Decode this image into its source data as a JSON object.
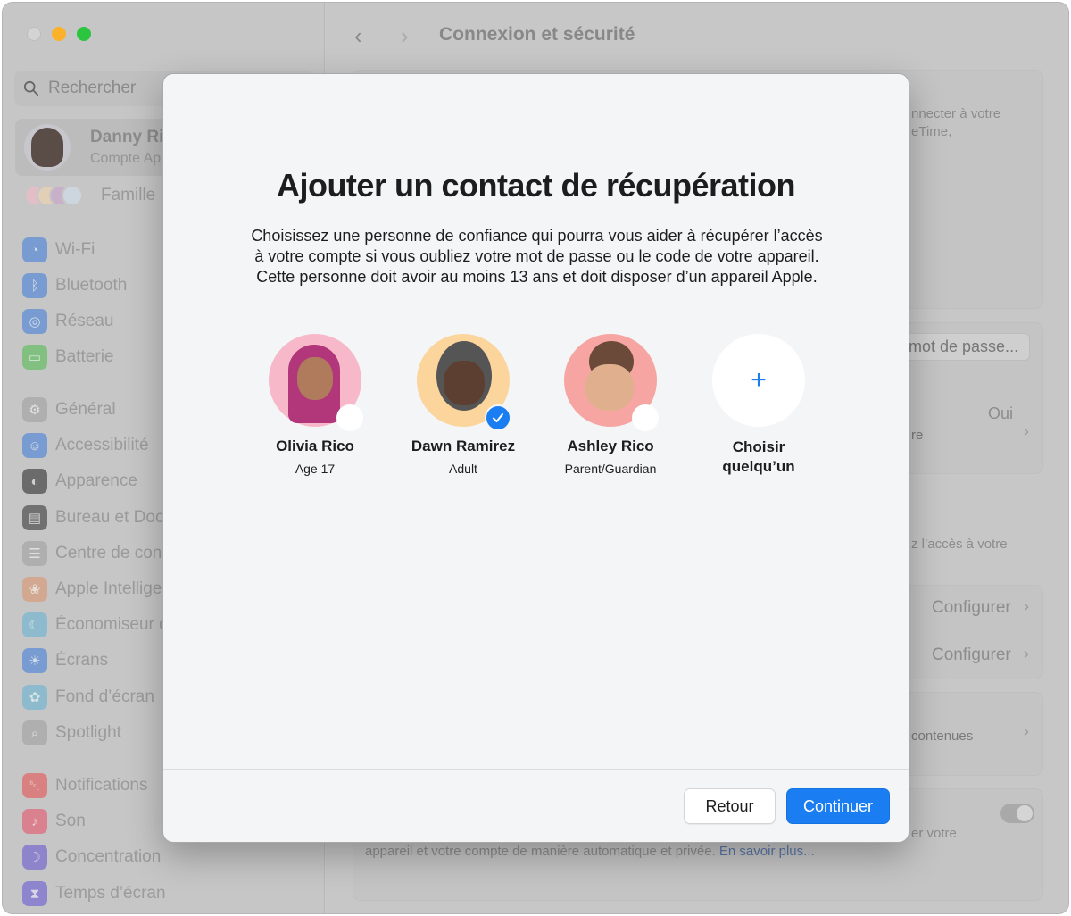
{
  "window": {
    "title": "Connexion et sécurité",
    "nav": {
      "back_icon": "chevron-left-icon",
      "forward_icon": "chevron-right-icon"
    }
  },
  "sidebar": {
    "search_placeholder": "Rechercher",
    "account": {
      "name": "Danny Rico",
      "subtitle": "Compte Apple"
    },
    "family_label": "Famille",
    "items": [
      {
        "label": "Wi-Fi",
        "icon": "wifi-icon",
        "color": "#5f8fd6"
      },
      {
        "label": "Bluetooth",
        "icon": "bluetooth-icon",
        "color": "#5f8fd6"
      },
      {
        "label": "Réseau",
        "icon": "globe-icon",
        "color": "#5f8fd6"
      },
      {
        "label": "Batterie",
        "icon": "battery-icon",
        "color": "#6bbf6b"
      },
      {
        "label": "Général",
        "icon": "gear-icon",
        "color": "#a8a8a8"
      },
      {
        "label": "Accessibilité",
        "icon": "accessibility-icon",
        "color": "#5f8fd6"
      },
      {
        "label": "Apparence",
        "icon": "appearance-icon",
        "color": "#4d4d4d"
      },
      {
        "label": "Bureau et Dock",
        "icon": "dock-icon",
        "color": "#555555"
      },
      {
        "label": "Centre de contrôle",
        "icon": "control-center-icon",
        "color": "#a8a8a8"
      },
      {
        "label": "Apple Intelligence",
        "icon": "apple-intelligence-icon",
        "color": "#d7a07f"
      },
      {
        "label": "Économiseur d'écran",
        "icon": "screensaver-icon",
        "color": "#7ab8d0"
      },
      {
        "label": "Écrans",
        "icon": "display-icon",
        "color": "#5f8fd6"
      },
      {
        "label": "Fond d’écran",
        "icon": "wallpaper-icon",
        "color": "#7ab8d0"
      },
      {
        "label": "Spotlight",
        "icon": "spotlight-icon",
        "color": "#a8a8a8"
      },
      {
        "label": "Notifications",
        "icon": "notifications-icon",
        "color": "#e06a6a"
      },
      {
        "label": "Son",
        "icon": "sound-icon",
        "color": "#e06a7c"
      },
      {
        "label": "Concentration",
        "icon": "focus-icon",
        "color": "#7a6fcf"
      },
      {
        "label": "Temps d’écran",
        "icon": "screen-time-icon",
        "color": "#7a6fcf"
      }
    ]
  },
  "main": {
    "fragments": {
      "sign_in_line1": "nnecter à votre",
      "sign_in_line2": "eTime,",
      "password_button": "mot de passe...",
      "yes_value": "Oui",
      "row_re": "re",
      "access_text": "z l’accès à votre",
      "configure_1": "Configurer",
      "configure_2": "Configurer",
      "contents": "contenues",
      "verify_text": "er votre",
      "footer_text": "appareil et votre compte de manière automatique et privée.",
      "footer_link": "En savoir plus..."
    }
  },
  "dialog": {
    "title": "Ajouter un contact de récupération",
    "body": "Choisissez une personne de confiance qui pourra vous aider à récupérer l’accès à votre compte si vous oubliez votre mot de passe ou le code de votre appareil. Cette personne doit avoir au moins 13 ans et doit disposer d’un appareil Apple.",
    "contacts": [
      {
        "name": "Olivia Rico",
        "role": "Age 17",
        "selected": false,
        "bg": "#f7b9c9"
      },
      {
        "name": "Dawn Ramirez",
        "role": "Adult",
        "selected": true,
        "bg": "#fbd59c"
      },
      {
        "name": "Ashley Rico",
        "role": "Parent/Guardian",
        "selected": false,
        "bg": "#f6a5a2"
      }
    ],
    "choose_someone": {
      "line1": "Choisir",
      "line2": "quelqu’un",
      "icon": "plus-icon"
    },
    "buttons": {
      "back": "Retour",
      "continue": "Continuer"
    },
    "accent_color": "#1a7ef2"
  }
}
